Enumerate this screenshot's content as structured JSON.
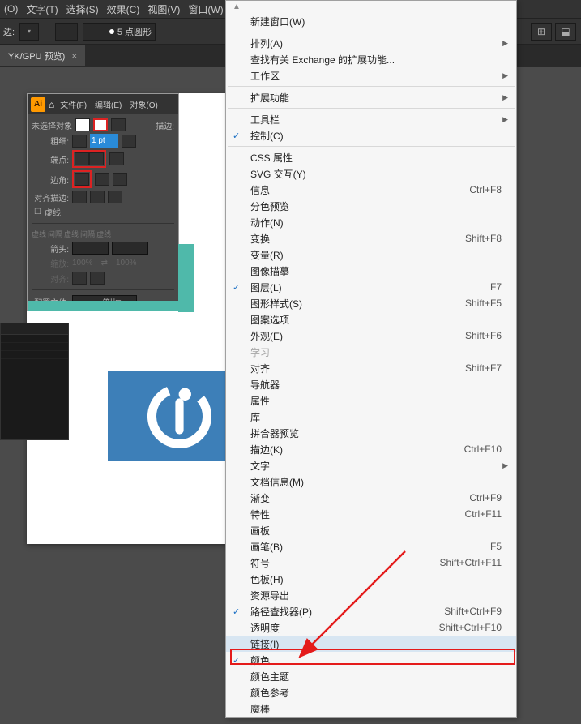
{
  "menubar": {
    "items": [
      "(O)",
      "文字(T)",
      "选择(S)",
      "效果(C)",
      "视图(V)",
      "窗口(W)"
    ]
  },
  "controlbar": {
    "edge_label": "边:",
    "shape_text": "5 点圆形"
  },
  "tab": {
    "title": "YK/GPU 预览)"
  },
  "ai_panel": {
    "logo": "Ai",
    "tabs": [
      "文件(F)",
      "编辑(E)",
      "对象(O)"
    ],
    "no_select": "未选择对象",
    "stroke_desc": "描边:",
    "weight_label": "粗细:",
    "weight_val": "1 pt",
    "cap_label": "端点:",
    "corner_label": "边角:",
    "align_label": "对齐描边:",
    "dashed": "虚线",
    "dashed_labels": [
      "虚线",
      "间隔",
      "虚线",
      "间隔",
      "虚线"
    ],
    "arrow_label": "箭头:",
    "scale_label": "缩放:",
    "scale1": "100%",
    "scale2": "100%",
    "align2_label": "对齐:",
    "profile_label": "配置文件:",
    "profile_val": "等比"
  },
  "dropdown": {
    "sections": [
      {
        "items": [
          {
            "label": "新建窗口(W)"
          }
        ]
      },
      {
        "items": [
          {
            "label": "排列(A)",
            "submenu": true
          },
          {
            "label": "查找有关 Exchange 的扩展功能..."
          },
          {
            "label": "工作区",
            "submenu": true
          }
        ]
      },
      {
        "items": [
          {
            "label": "扩展功能",
            "submenu": true
          }
        ]
      },
      {
        "items": [
          {
            "label": "工具栏",
            "submenu": true
          },
          {
            "label": "控制(C)",
            "checked": true
          }
        ]
      },
      {
        "items": [
          {
            "label": "CSS 属性"
          },
          {
            "label": "SVG 交互(Y)"
          },
          {
            "label": "信息",
            "shortcut": "Ctrl+F8"
          },
          {
            "label": "分色预览"
          },
          {
            "label": "动作(N)"
          },
          {
            "label": "变换",
            "shortcut": "Shift+F8"
          },
          {
            "label": "变量(R)"
          },
          {
            "label": "图像描摹"
          },
          {
            "label": "图层(L)",
            "shortcut": "F7",
            "checked": true
          },
          {
            "label": "图形样式(S)",
            "shortcut": "Shift+F5"
          },
          {
            "label": "图案选项"
          },
          {
            "label": "外观(E)",
            "shortcut": "Shift+F6"
          },
          {
            "label": "学习",
            "disabled": true
          },
          {
            "label": "对齐",
            "shortcut": "Shift+F7"
          },
          {
            "label": "导航器"
          },
          {
            "label": "属性"
          },
          {
            "label": "库"
          },
          {
            "label": "拼合器预览"
          },
          {
            "label": "描边(K)",
            "shortcut": "Ctrl+F10"
          },
          {
            "label": "文字",
            "submenu": true
          },
          {
            "label": "文档信息(M)"
          },
          {
            "label": "渐变",
            "shortcut": "Ctrl+F9"
          },
          {
            "label": "特性",
            "shortcut": "Ctrl+F11"
          },
          {
            "label": "画板"
          },
          {
            "label": "画笔(B)",
            "shortcut": "F5"
          },
          {
            "label": "符号",
            "shortcut": "Shift+Ctrl+F11"
          },
          {
            "label": "色板(H)"
          },
          {
            "label": "资源导出"
          },
          {
            "label": "路径查找器(P)",
            "shortcut": "Shift+Ctrl+F9",
            "checked": true
          },
          {
            "label": "透明度",
            "shortcut": "Shift+Ctrl+F10"
          },
          {
            "label": "链接(I)",
            "highlighted": true
          },
          {
            "label": "颜色",
            "checked": true
          },
          {
            "label": "颜色主题"
          },
          {
            "label": "颜色参考"
          },
          {
            "label": "魔棒"
          }
        ]
      }
    ]
  }
}
